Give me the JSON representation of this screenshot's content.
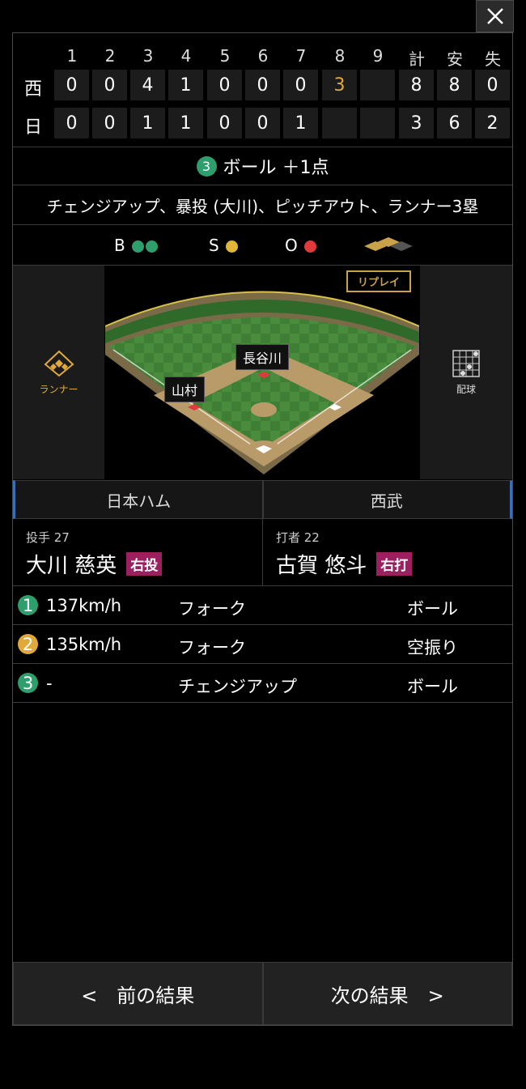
{
  "scoreboard": {
    "innings": [
      "1",
      "2",
      "3",
      "4",
      "5",
      "6",
      "7",
      "8",
      "9"
    ],
    "totals_headers": [
      "計",
      "安",
      "失"
    ],
    "rows": [
      {
        "team": "西",
        "scores": [
          "0",
          "0",
          "4",
          "1",
          "0",
          "0",
          "0",
          "3",
          ""
        ],
        "totals": [
          "8",
          "8",
          "0"
        ]
      },
      {
        "team": "日",
        "scores": [
          "0",
          "0",
          "1",
          "1",
          "0",
          "0",
          "1",
          "",
          ""
        ],
        "totals": [
          "3",
          "6",
          "2"
        ]
      }
    ],
    "highlight_color": "#e0a93a"
  },
  "event": {
    "number": "3",
    "text": "ボール ＋1点"
  },
  "description": "チェンジアップ、暴投 (大川)、ピッチアウト、ランナー3塁",
  "count": {
    "b_label": "B",
    "s_label": "S",
    "o_label": "O",
    "balls": 2,
    "strikes": 1,
    "outs": 1
  },
  "field": {
    "replay_label": "リプレイ",
    "runner_label": "ランナー",
    "pitch_label": "配球",
    "fielders": [
      {
        "name": "長谷川"
      },
      {
        "name": "山村"
      }
    ]
  },
  "teams": {
    "left": "日本ハム",
    "right": "西武"
  },
  "pitcher": {
    "role": "投手 27",
    "name": "大川 慈英",
    "badge": "右投"
  },
  "batter": {
    "role": "打者 22",
    "name": "古賀 悠斗",
    "badge": "右打"
  },
  "pitches": [
    {
      "num": "1",
      "speed": "137km/h",
      "type": "フォーク",
      "result": "ボール",
      "color": "green"
    },
    {
      "num": "2",
      "speed": "135km/h",
      "type": "フォーク",
      "result": "空振り",
      "color": "yellow"
    },
    {
      "num": "3",
      "speed": "-",
      "type": "チェンジアップ",
      "result": "ボール",
      "color": "green"
    }
  ],
  "footer": {
    "prev": "<　前の結果",
    "next": "次の結果　>"
  }
}
